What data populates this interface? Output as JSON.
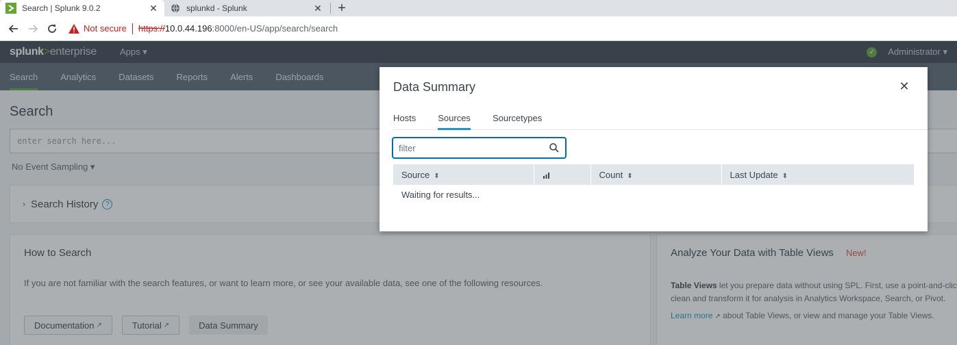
{
  "browser": {
    "tabs": [
      {
        "title": "Search | Splunk 9.0.2",
        "active": true
      },
      {
        "title": "splunkd - Splunk",
        "active": false
      }
    ],
    "close_glyph": "✕",
    "new_tab_glyph": "+",
    "security_label": "Not secure",
    "url_scheme": "https://",
    "url_host": "10.0.44.196",
    "url_path": ":8000/en-US/app/search/search"
  },
  "splunk": {
    "logo_main": "splunk",
    "logo_gt": ">",
    "logo_sub": "enterprise",
    "apps_menu": "Apps ▾",
    "user_menu": "Administrator ▾",
    "nav": [
      {
        "label": "Search",
        "active": true
      },
      {
        "label": "Analytics"
      },
      {
        "label": "Datasets"
      },
      {
        "label": "Reports"
      },
      {
        "label": "Alerts"
      },
      {
        "label": "Dashboards"
      }
    ],
    "page_title": "Search",
    "search_placeholder": "enter search here...",
    "sampling_label": "No Event Sampling ▾",
    "history_label": "Search History",
    "how_to": {
      "title": "How to Search",
      "text": "If you are not familiar with the search features, or want to learn more, or see your available data, see one of the following resources.",
      "buttons": [
        "Documentation",
        "Tutorial",
        "Data Summary"
      ]
    },
    "analyze": {
      "title": "Analyze Your Data with Table Views",
      "badge": "New!",
      "text_bold": "Table Views",
      "text_line1": " let you prepare data without using SPL. First, use a point-and-click interface to select data.",
      "text_line2": "clean and transform it for analysis in Analytics Workspace, Search, or Pivot.",
      "learn_more": "Learn more",
      "learn_rest": " about Table Views, or view and manage your Table Views."
    }
  },
  "modal": {
    "title": "Data Summary",
    "close_glyph": "✕",
    "tabs": [
      {
        "label": "Hosts",
        "active": false
      },
      {
        "label": "Sources",
        "active": true
      },
      {
        "label": "Sourcetypes",
        "active": false
      }
    ],
    "filter_placeholder": "filter",
    "columns": [
      "Source",
      "",
      "Count",
      "Last Update"
    ],
    "sort_glyph": "⬍",
    "status": "Waiting for results..."
  },
  "colors": {
    "splunk_green": "#65a637",
    "link_blue": "#1e93c6",
    "focus_blue": "#006eaa",
    "insecure_red": "#c5221f"
  }
}
